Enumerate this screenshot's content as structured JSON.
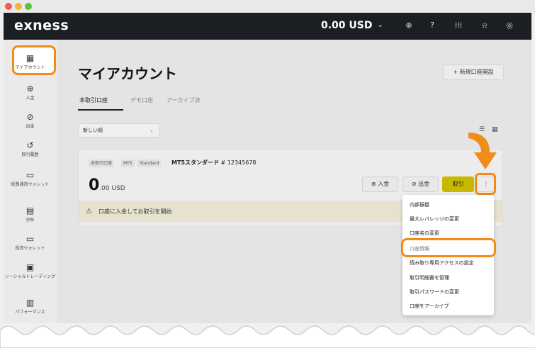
{
  "brand": {
    "logo": "exness",
    "balance": "0.00 USD",
    "accent": "#f28c19",
    "trade_color": "#c9b800"
  },
  "topbar_icons": [
    "globe-icon",
    "help-icon",
    "apps-grid-icon",
    "bell-icon",
    "user-icon"
  ],
  "sidebar": {
    "items": [
      {
        "label": "マイアカウント",
        "icon": "dashboard-icon"
      },
      {
        "label": "入金",
        "icon": "deposit-icon"
      },
      {
        "label": "出金",
        "icon": "withdraw-icon"
      },
      {
        "label": "取引履歴",
        "icon": "history-icon"
      },
      {
        "label": "仮想通貨ウォレット",
        "icon": "crypto-wallet-icon"
      },
      {
        "label": "分析",
        "icon": "analytics-icon"
      },
      {
        "label": "投資ウォレット",
        "icon": "invest-wallet-icon"
      },
      {
        "label": "ソーシャルトレーディング",
        "icon": "social-trading-icon"
      },
      {
        "label": "パフォーマンス",
        "icon": "performance-icon"
      }
    ]
  },
  "main": {
    "title": "マイアカウント",
    "new_account_label": "+ 新規口座開設",
    "tabs": [
      {
        "label": "本取引口座"
      },
      {
        "label": "デモ口座"
      },
      {
        "label": "アーカイブ済"
      }
    ],
    "sort": {
      "value": "新しい順"
    },
    "account": {
      "badges": [
        "本取引口座",
        "MT5",
        "Standard"
      ],
      "name": "MT5スタンダード",
      "number": "# 12345678",
      "balance_main": "0",
      "balance_sub": ".00 USD",
      "deposit_label": "入金",
      "withdraw_label": "出金",
      "trade_label": "取引",
      "more_label": "⋮",
      "notice": "口座に入金してお取引を開始"
    },
    "menu": [
      "内部振替",
      "最大レバレッジの変更",
      "口座名の変更",
      "口座情報",
      "読み取り専用アクセスの設定",
      "取引明細書を管理",
      "取引パスワードの変更",
      "口座をアーカイブ"
    ]
  }
}
